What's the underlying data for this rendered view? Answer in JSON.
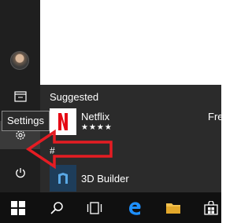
{
  "rail": {
    "avatar_icon": "user-avatar",
    "items": [
      {
        "icon": "file-explorer-icon"
      },
      {
        "icon": "settings-gear-icon"
      },
      {
        "icon": "power-icon"
      }
    ]
  },
  "tooltip": {
    "text": "Settings"
  },
  "suggested": {
    "header": "Suggested",
    "app_name": "Netflix",
    "rating": "★★★★",
    "cut_off_label": "Fre"
  },
  "apps": {
    "letter": "#",
    "items": [
      {
        "name": "3D Builder",
        "icon": "3d-builder-icon"
      }
    ]
  },
  "annotation": {
    "color": "#e51c23",
    "points_to": "Settings"
  },
  "taskbar": {
    "items": [
      {
        "name": "start",
        "icon": "windows-logo-icon"
      },
      {
        "name": "search",
        "icon": "search-icon"
      },
      {
        "name": "task-view",
        "icon": "task-view-icon"
      },
      {
        "name": "edge",
        "icon": "edge-icon"
      },
      {
        "name": "file-explorer",
        "icon": "folder-icon"
      },
      {
        "name": "store",
        "icon": "store-icon"
      }
    ]
  }
}
